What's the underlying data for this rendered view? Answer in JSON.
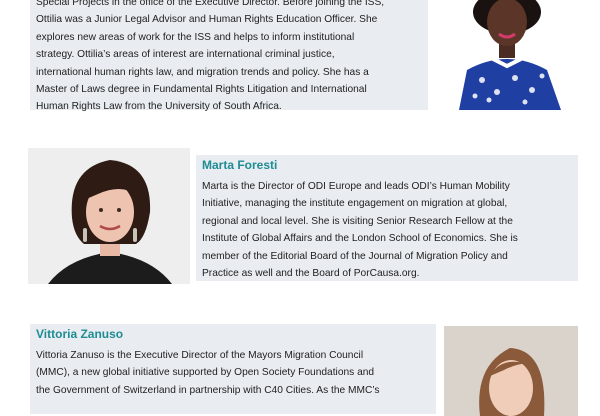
{
  "profiles": [
    {
      "name": "",
      "bio_lines": [
        "Special Projects in the office of the Executive Director. Before joining the ISS,",
        "Ottilia was a Junior Legal Advisor and Human Rights Education Officer. She",
        "explores new areas of work for the ISS and helps to inform institutional",
        "strategy. Ottilia’s areas of interest are international criminal justice,",
        "international human rights law, and migration trends and policy. She has a",
        "Master of Laws degree in Fundamental Rights Litigation and International",
        "Human Rights Law from the University of South Africa."
      ]
    },
    {
      "name": "Marta Foresti",
      "bio_lines": [
        "Marta is the Director of ODI Europe and leads ODI’s Human Mobility",
        "Initiative, managing the institute engagement on migration at global,",
        "regional and local level. She is visiting Senior Research Fellow at the",
        "Institute of Global Affairs and the London School of Economics. She is",
        "member of the Editorial Board of the Journal of Migration Policy and",
        "Practice as well and the Board of PorCausa.org."
      ]
    },
    {
      "name": "Vittoria Zanuso",
      "bio_lines": [
        "Vittoria Zanuso is the Executive Director of the Mayors Migration Council",
        "(MMC), a new global initiative supported by Open Society Foundations and",
        "the Government of Switzerland in partnership with C40 Cities. As the MMC’s"
      ]
    }
  ],
  "colors": {
    "name_accent": "#1e8c93",
    "card_background": "#e9edf1"
  }
}
